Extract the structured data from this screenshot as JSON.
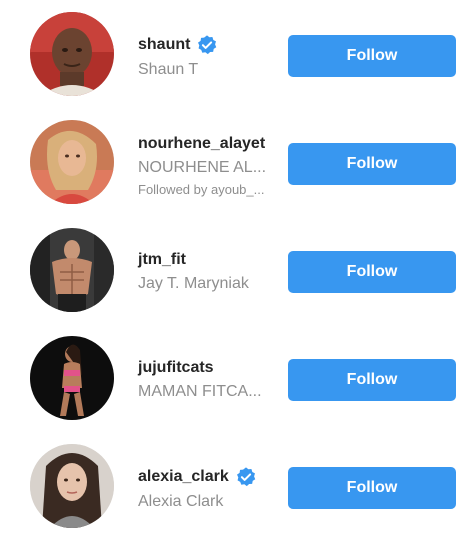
{
  "suggestions": [
    {
      "username": "shaunt",
      "full_name": "Shaun T",
      "verified": true,
      "followed_by": "",
      "follow_label": "Follow",
      "avatar": "avatar-shaunt"
    },
    {
      "username": "nourhene_alayet",
      "full_name": "NOURHENE AL...",
      "verified": false,
      "followed_by": "Followed by ayoub_...",
      "follow_label": "Follow",
      "avatar": "avatar-nourhene-alayet"
    },
    {
      "username": "jtm_fit",
      "full_name": "Jay T. Maryniak",
      "verified": false,
      "followed_by": "",
      "follow_label": "Follow",
      "avatar": "avatar-jtm-fit"
    },
    {
      "username": "jujufitcats",
      "full_name": "MAMAN FITCA...",
      "verified": false,
      "followed_by": "",
      "follow_label": "Follow",
      "avatar": "avatar-jujufitcats"
    },
    {
      "username": "alexia_clark",
      "full_name": "Alexia Clark",
      "verified": true,
      "followed_by": "",
      "follow_label": "Follow",
      "avatar": "avatar-alexia-clark"
    }
  ],
  "colors": {
    "follow_button_bg": "#3897f0",
    "follow_button_text": "#ffffff",
    "username": "#262626",
    "secondary_text": "#8e8e8e",
    "verified_badge": "#3897f0"
  },
  "icons": {
    "verified": "verified-badge-icon"
  }
}
